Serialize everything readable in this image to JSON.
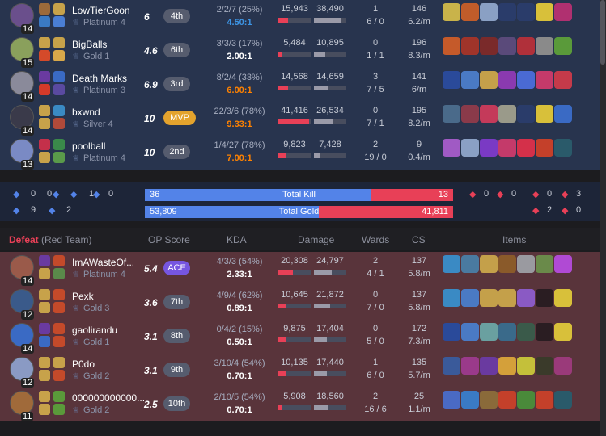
{
  "win_rows": [
    {
      "level": "14",
      "name": "LowTierGoon",
      "tier": "Platinum 4",
      "kp": "6",
      "rank": "4th",
      "kda": "2/2/7 (25%)",
      "ratio": "4.50:1",
      "ratio_color": "#3d95e5",
      "dmg_dealt": "15,943",
      "dmg_taken": "38,490",
      "wards1": "1",
      "wards2": "6 / 0",
      "cs1": "146",
      "cs2": "6.2/m",
      "champ": "#6a4f8c",
      "s1": "#9c6a3a",
      "s2": "#3a7ac4",
      "r1": "#c7a24a",
      "r2": "#4a7ed4",
      "dealt_fill": 0.3,
      "taken_fill": 0.85,
      "items": [
        "#c9b34a",
        "#c05c2a",
        "#8aa0c4",
        "#2a3c6a",
        "#2a3c6a",
        "#d8c03a",
        "#b03070"
      ]
    },
    {
      "level": "15",
      "name": "BigBalls",
      "tier": "Gold 1",
      "kp": "4.6",
      "rank": "6th",
      "kda": "3/3/3 (17%)",
      "ratio": "2.00:1",
      "ratio_color": "#ffffff",
      "dmg_dealt": "5,484",
      "dmg_taken": "10,895",
      "wards1": "0",
      "wards2": "1 / 1",
      "cs1": "196",
      "cs2": "8.3/m",
      "champ": "#8aa05c",
      "s1": "#c7a24a",
      "s2": "#d44a2a",
      "r1": "#c7a24a",
      "r2": "#d8a84a",
      "dealt_fill": 0.12,
      "taken_fill": 0.35,
      "items": [
        "#c55a2a",
        "#a0342a",
        "#7a2a2a",
        "#5a4a7a",
        "#b0303a",
        "#8a8a8a",
        "#5a9a3a"
      ]
    },
    {
      "level": "14",
      "name": "Death Marks",
      "tier": "Platinum 3",
      "kp": "6.9",
      "rank": "3rd",
      "kda": "8/2/4 (33%)",
      "ratio": "6.00:1",
      "ratio_color": "#ff8200",
      "dmg_dealt": "14,568",
      "dmg_taken": "14,659",
      "wards1": "3",
      "wards2": "7 / 5",
      "cs1": "141",
      "cs2": "6/m",
      "champ": "#8a8a9a",
      "s1": "#6a3aa0",
      "s2": "#d43a2a",
      "r1": "#3a6ac4",
      "r2": "#5a4aa0",
      "dealt_fill": 0.3,
      "taken_fill": 0.45,
      "items": [
        "#2a4a9a",
        "#4a7ac4",
        "#c4a04a",
        "#8a3ab0",
        "#4a6ad4",
        "#c43a6a",
        "#c43a4a"
      ]
    },
    {
      "level": "14",
      "name": "bxwnd",
      "tier": "Silver 4",
      "kp": "10",
      "rank": "MVP",
      "kda": "22/3/6 (78%)",
      "ratio": "9.33:1",
      "ratio_color": "#ff8200",
      "dmg_dealt": "41,416",
      "dmg_taken": "26,534",
      "wards1": "0",
      "wards2": "7 / 1",
      "cs1": "195",
      "cs2": "8.2/m",
      "champ": "#3a3a4a",
      "s1": "#c7a24a",
      "s2": "#c7a24a",
      "r1": "#3a8ac4",
      "r2": "#b04a3a",
      "dealt_fill": 0.95,
      "taken_fill": 0.6,
      "items": [
        "#4a6a8a",
        "#8a3a4a",
        "#c43a5a",
        "#9a9a8a",
        "#2a3c6a",
        "#d8c03a",
        "#3a6ac4"
      ]
    },
    {
      "level": "13",
      "name": "poolball",
      "tier": "Platinum 4",
      "kp": "10",
      "rank": "2nd",
      "kda": "1/4/27 (78%)",
      "ratio": "7.00:1",
      "ratio_color": "#ff8200",
      "dmg_dealt": "9,823",
      "dmg_taken": "7,428",
      "wards1": "2",
      "wards2": "19 / 0",
      "cs1": "9",
      "cs2": "0.4/m",
      "champ": "#7a8ac4",
      "s1": "#c4304a",
      "s2": "#c7a24a",
      "r1": "#3a8a4a",
      "r2": "#5a9a4a",
      "dealt_fill": 0.22,
      "taken_fill": 0.2,
      "items": [
        "#a05ac4",
        "#8aa0c4",
        "#7a3ac4",
        "#c43a6a",
        "#d4304a",
        "#c4402a",
        "#2a5a6a"
      ]
    }
  ],
  "summary": {
    "blue_obj": [
      "0",
      "0",
      "1",
      "0",
      "9",
      "2"
    ],
    "total_kill_label": "Total Kill",
    "total_gold_label": "Total Gold",
    "blue_kill": "36",
    "red_kill": "13",
    "blue_gold": "53,809",
    "red_gold": "41,811",
    "kill_fraction": 0.735,
    "gold_fraction": 0.563,
    "red_obj": [
      "0",
      "0",
      "0",
      "3",
      "2",
      "0"
    ]
  },
  "header": {
    "result": "Defeat",
    "team": "(Red Team)",
    "op": "OP Score",
    "kda": "KDA",
    "damage": "Damage",
    "wards": "Wards",
    "cs": "CS",
    "items": "Items"
  },
  "lose_rows": [
    {
      "level": "14",
      "name": "ImAWasteOf...",
      "tier": "Platinum 4",
      "kp": "5.4",
      "rank": "ACE",
      "kda": "4/3/3 (54%)",
      "ratio": "2.33:1",
      "ratio_color": "#ffffff",
      "dmg_dealt": "20,308",
      "dmg_taken": "24,797",
      "wards1": "2",
      "wards2": "4 / 1",
      "cs1": "137",
      "cs2": "5.8/m",
      "champ": "#9a5a4a",
      "s1": "#6a3aa0",
      "s2": "#c7a24a",
      "r1": "#c44a2a",
      "r2": "#5a8a4a",
      "dealt_fill": 0.45,
      "taken_fill": 0.55,
      "items": [
        "#3a8ac4",
        "#4a7aa0",
        "#c4a04a",
        "#8a5a2a",
        "#9a9aa0",
        "#6a8a4a",
        "#b04ad4"
      ]
    },
    {
      "level": "12",
      "name": "Pexk",
      "tier": "Gold 3",
      "kp": "3.6",
      "rank": "7th",
      "kda": "4/9/4 (62%)",
      "ratio": "0.89:1",
      "ratio_color": "#ffffff",
      "dmg_dealt": "10,645",
      "dmg_taken": "21,872",
      "wards1": "0",
      "wards2": "7 / 0",
      "cs1": "137",
      "cs2": "5.8/m",
      "champ": "#3a5a8a",
      "s1": "#c7a24a",
      "s2": "#c7a24a",
      "r1": "#c44a2a",
      "r2": "#c44a2a",
      "dealt_fill": 0.25,
      "taken_fill": 0.5,
      "items": [
        "#3a8ac4",
        "#4a7ac4",
        "#c4a04a",
        "#c4a04a",
        "#8a5ac4",
        "#2a1d22",
        "#d8c03a"
      ]
    },
    {
      "level": "14",
      "name": "gaolirandu",
      "tier": "Gold 1",
      "kp": "3.1",
      "rank": "8th",
      "kda": "0/4/2 (15%)",
      "ratio": "0.50:1",
      "ratio_color": "#ffffff",
      "dmg_dealt": "9,875",
      "dmg_taken": "17,404",
      "wards1": "0",
      "wards2": "5 / 0",
      "cs1": "172",
      "cs2": "7.3/m",
      "champ": "#3a6ac4",
      "s1": "#6a3aa0",
      "s2": "#3a6ac4",
      "r1": "#c44a2a",
      "r2": "#c44a2a",
      "dealt_fill": 0.22,
      "taken_fill": 0.4,
      "items": [
        "#2a4a9a",
        "#4a7ac4",
        "#6aa0a0",
        "#3a6a8a",
        "#3a5a4a",
        "#2a1d22",
        "#d8c03a"
      ]
    },
    {
      "level": "12",
      "name": "P0do",
      "tier": "Gold 2",
      "kp": "3.1",
      "rank": "9th",
      "kda": "3/10/4 (54%)",
      "ratio": "0.70:1",
      "ratio_color": "#ffffff",
      "dmg_dealt": "10,135",
      "dmg_taken": "17,440",
      "wards1": "1",
      "wards2": "6 / 0",
      "cs1": "135",
      "cs2": "5.7/m",
      "champ": "#8a9ac4",
      "s1": "#c7a24a",
      "s2": "#c7a24a",
      "r1": "#c7a24a",
      "r2": "#c44a2a",
      "dealt_fill": 0.23,
      "taken_fill": 0.4,
      "items": [
        "#3a5a9a",
        "#9a3a8a",
        "#6a3aa0",
        "#d4a03a",
        "#c4c03a",
        "#3a3a2a",
        "#9a3a7a"
      ]
    },
    {
      "level": "11",
      "name": "000000000000...",
      "tier": "Gold 2",
      "kp": "2.5",
      "rank": "10th",
      "kda": "2/10/5 (54%)",
      "ratio": "0.70:1",
      "ratio_color": "#ffffff",
      "dmg_dealt": "5,908",
      "dmg_taken": "18,560",
      "wards1": "2",
      "wards2": "16 / 6",
      "cs1": "25",
      "cs2": "1.1/m",
      "champ": "#a06a3a",
      "s1": "#c7a24a",
      "s2": "#c7a24a",
      "r1": "#5a9a3a",
      "r2": "#5a9a3a",
      "dealt_fill": 0.12,
      "taken_fill": 0.42,
      "items": [
        "#4a6ac4",
        "#3a7ac4",
        "#8a6a3a",
        "#c4402a",
        "#4a8a3a",
        "#c4402a",
        "#2a5a6a"
      ]
    }
  ]
}
